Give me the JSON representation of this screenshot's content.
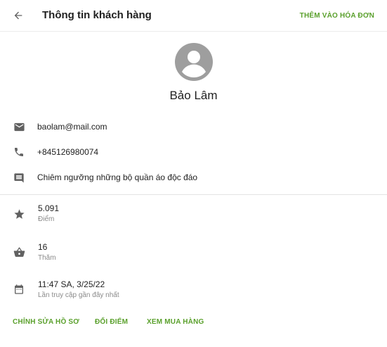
{
  "header": {
    "title": "Thông tin khách hàng",
    "action_label": "THÊM VÀO HÓA ĐƠN"
  },
  "profile": {
    "name": "Bảo Lâm"
  },
  "contact": {
    "email": "baolam@mail.com",
    "phone": "+845126980074",
    "note": "Chiêm ngưỡng những bộ quần áo độc đáo"
  },
  "stats": [
    {
      "value": "5.091",
      "caption": "Điểm",
      "icon": "star-icon"
    },
    {
      "value": "16",
      "caption": "Thăm",
      "icon": "basket-icon"
    },
    {
      "value": "11:47 SA, 3/25/22",
      "caption": "Lần truy cập gần đây nhất",
      "icon": "calendar-icon"
    }
  ],
  "actions": {
    "edit_profile": "CHỈNH SỬA HỒ SƠ",
    "redeem_points": "ĐỔI ĐIỂM",
    "view_purchases": "XEM MUA HÀNG"
  },
  "colors": {
    "accent": "#5aa02c",
    "icon": "#616161",
    "avatar": "#9e9e9e"
  }
}
